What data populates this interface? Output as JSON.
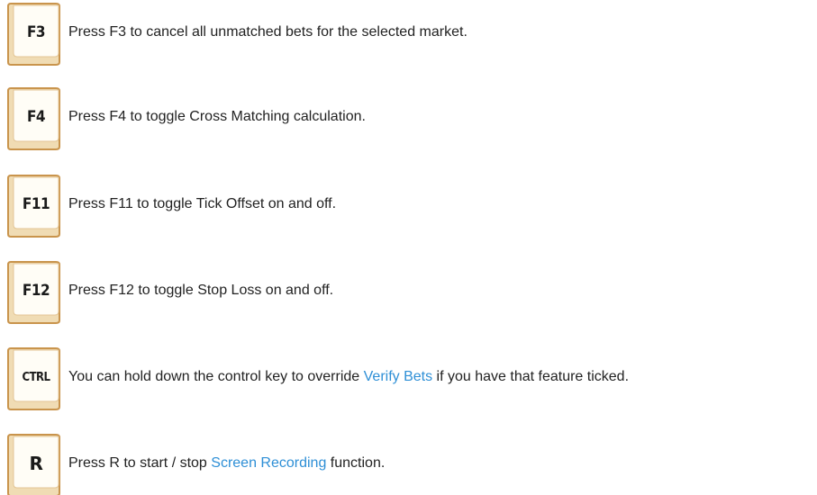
{
  "colors": {
    "key_face": "#fffdf6",
    "key_border": "#c9944c",
    "key_edge": "#f0dcb4",
    "text": "#222222",
    "link": "#2e8fd6"
  },
  "shortcuts": [
    {
      "key": "F3",
      "text": "Press F3 to cancel all unmatched bets for the selected market.",
      "text_before": "Press F3 to cancel all unmatched bets for the selected market.",
      "link": "",
      "text_after": ""
    },
    {
      "key": "F4",
      "text_before": "Press F4 to toggle Cross Matching calculation.",
      "link": "",
      "text_after": ""
    },
    {
      "key": "F11",
      "text_before": "Press F11 to toggle Tick Offset on and off.",
      "link": "",
      "text_after": ""
    },
    {
      "key": "F12",
      "text_before": "Press F12 to toggle Stop Loss on and off.",
      "link": "",
      "text_after": ""
    },
    {
      "key": "CTRL",
      "text_before": "You can hold down the control key to override ",
      "link": "Verify Bets",
      "text_after": " if you have that feature ticked."
    },
    {
      "key": "R",
      "text_before": "Press R to start / stop ",
      "link": "Screen Recording",
      "text_after": " function."
    }
  ]
}
